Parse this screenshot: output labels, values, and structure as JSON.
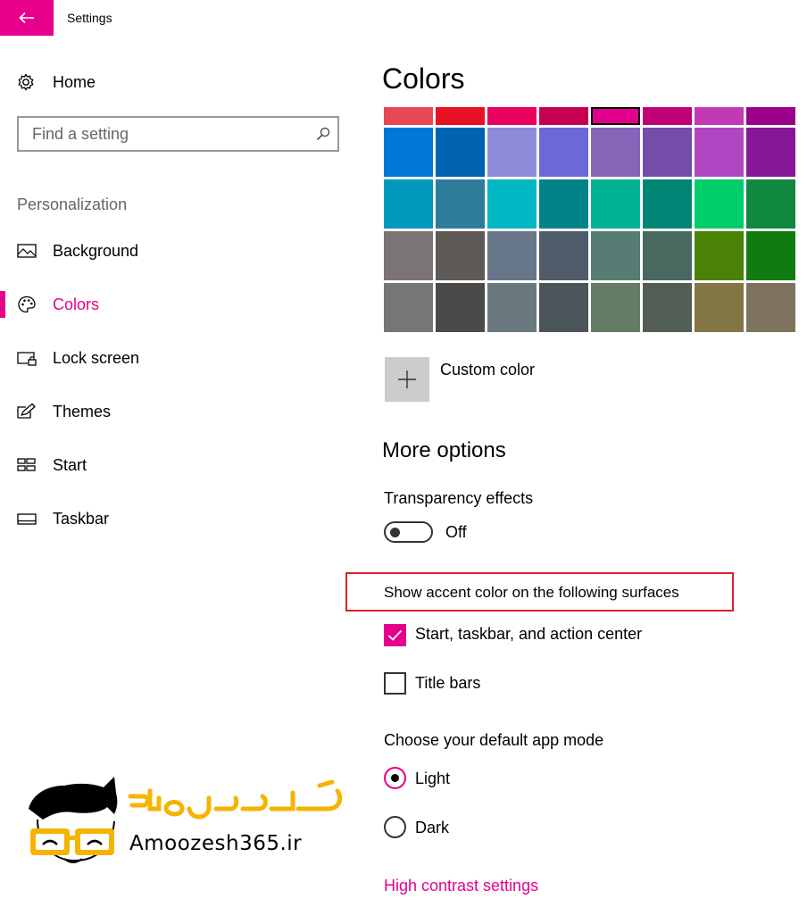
{
  "app": {
    "title": "Settings"
  },
  "sidebar": {
    "home_label": "Home",
    "search_placeholder": "Find a setting",
    "section_label": "Personalization",
    "items": [
      {
        "label": "Background",
        "icon": "picture-icon",
        "active": false
      },
      {
        "label": "Colors",
        "icon": "palette-icon",
        "active": true
      },
      {
        "label": "Lock screen",
        "icon": "lock-screen-icon",
        "active": false
      },
      {
        "label": "Themes",
        "icon": "themes-icon",
        "active": false
      },
      {
        "label": "Start",
        "icon": "start-tiles-icon",
        "active": false
      },
      {
        "label": "Taskbar",
        "icon": "taskbar-icon",
        "active": false
      }
    ]
  },
  "colors": {
    "page_title": "Colors",
    "selected_color": "#e3008c",
    "swatch_rows": [
      [
        "#e74856",
        "#e81123",
        "#ea005e",
        "#c30052",
        "#e3008c",
        "#bf0077",
        "#c239b3",
        "#9a0089"
      ],
      [
        "#0078d7",
        "#0063b1",
        "#8e8cd8",
        "#6b69d6",
        "#8764b8",
        "#744da9",
        "#b146c2",
        "#881798"
      ],
      [
        "#0099bc",
        "#2d7d9a",
        "#00b7c3",
        "#038387",
        "#00b294",
        "#018574",
        "#00cc6a",
        "#10893e"
      ],
      [
        "#7a7574",
        "#5d5a58",
        "#68768a",
        "#515c6b",
        "#567c73",
        "#486860",
        "#498205",
        "#107c10"
      ],
      [
        "#767676",
        "#4c4a48",
        "#69797e",
        "#4a5459",
        "#647c64",
        "#525e54",
        "#847545",
        "#7e735f"
      ]
    ],
    "custom_color_label": "Custom color"
  },
  "more_options": {
    "title": "More options",
    "transparency": {
      "label": "Transparency effects",
      "state": "Off",
      "enabled": false
    },
    "accent_surfaces": {
      "label": "Show accent color on the following surfaces",
      "options": [
        {
          "label": "Start, taskbar, and action center",
          "checked": true
        },
        {
          "label": "Title bars",
          "checked": false
        }
      ]
    },
    "app_mode": {
      "label": "Choose your default app mode",
      "options": [
        {
          "label": "Light",
          "selected": true
        },
        {
          "label": "Dark",
          "selected": false
        }
      ]
    },
    "high_contrast_link": "High contrast settings"
  },
  "watermark": {
    "text": "Amoozesh365.ir",
    "logo_lettering": "آموزش ۳۶۵"
  },
  "theme": {
    "accent": "#e6008b",
    "highlight_border": "#e0202b",
    "watermark_yellow": "#f5b400"
  }
}
